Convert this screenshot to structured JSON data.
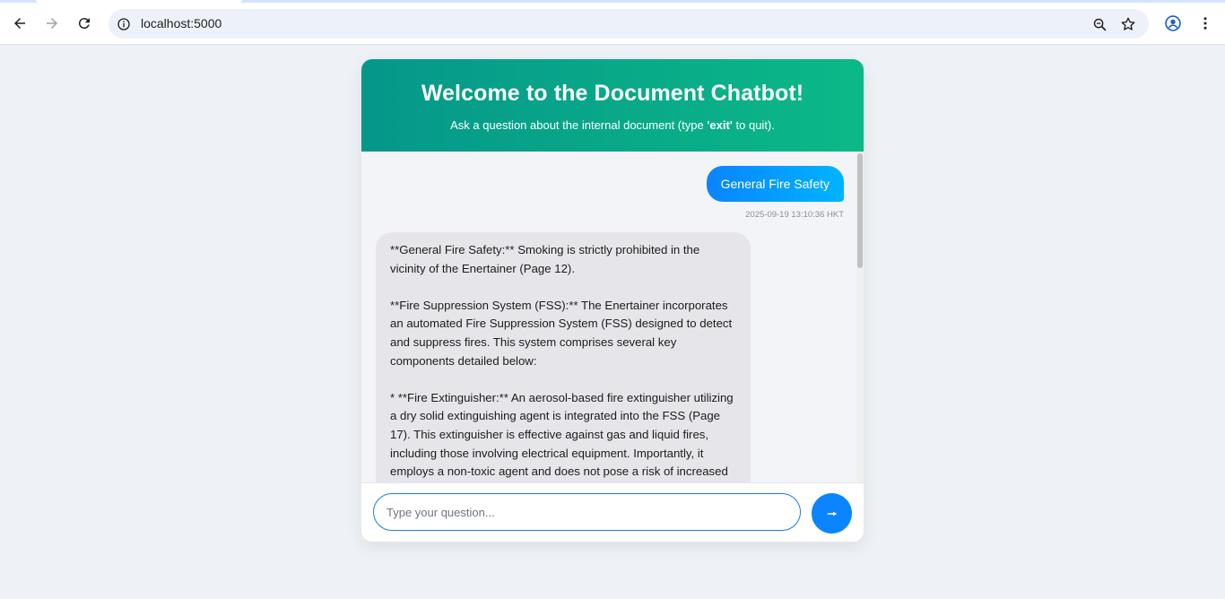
{
  "browser": {
    "url": "localhost:5000",
    "icons": {
      "back": "back-arrow-icon",
      "forward": "forward-arrow-icon",
      "reload": "reload-icon",
      "site_info": "site-info-icon",
      "zoom": "zoom-icon",
      "bookmark": "star-icon",
      "profile": "profile-icon",
      "menu": "kebab-menu-icon"
    }
  },
  "header": {
    "title": "Welcome to the Document Chatbot!",
    "subtitle_before": "Ask a question about the internal document (type ",
    "subtitle_keyword": "'exit'",
    "subtitle_after": " to quit)."
  },
  "messages": {
    "user": {
      "text": "General Fire Safety",
      "timestamp": "2025-09-19 13:10:36 HKT"
    },
    "bot": {
      "paragraphs": [
        "**General Fire Safety:** Smoking is strictly prohibited in the vicinity of the Enertainer (Page 12).",
        "**Fire Suppression System (FSS):** The Enertainer incorporates an automated Fire Suppression System (FSS) designed to detect and suppress fires. This system comprises several key components detailed below:",
        "* **Fire Extinguisher:** An aerosol-based fire extinguisher utilizing a dry solid extinguishing agent is integrated into the FSS (Page 17). This extinguisher is effective against gas and liquid fires, including those involving electrical equipment. Importantly, it employs a non-toxic agent and does not pose a risk of increased air pressure (Page"
      ]
    }
  },
  "input": {
    "placeholder": "Type your question...",
    "value": ""
  },
  "colors": {
    "header_gradient_start": "#05978a",
    "header_gradient_end": "#0bb987",
    "user_bubble": "#0a84ff",
    "bot_bubble": "#e6e6ea",
    "send_button": "#0a84ff",
    "page_background": "#eef1f5"
  }
}
